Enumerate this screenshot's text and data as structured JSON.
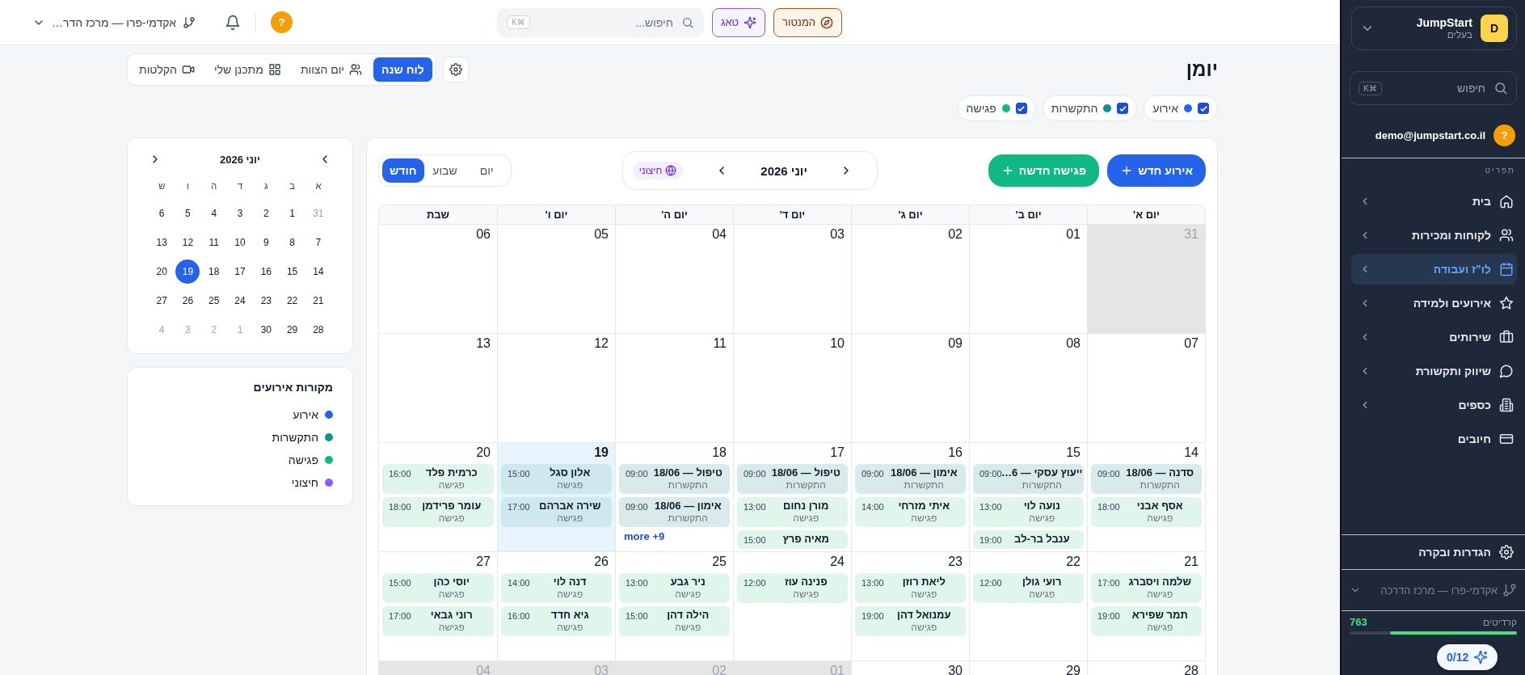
{
  "sidebar": {
    "workspace": {
      "avatar": "D",
      "name": "JumpStart",
      "role": "בעלים"
    },
    "search": {
      "placeholder": "חיפוש",
      "shortcut": "⌘K"
    },
    "user": {
      "avatar": "?",
      "email": "demo@jumpstart.co.il"
    },
    "section_label": "תפריט",
    "items": [
      {
        "label": "בית",
        "selected": false,
        "expandable": true
      },
      {
        "label": "לקוחות ומכירות",
        "selected": false,
        "expandable": true
      },
      {
        "label": "לו\"ז ועבודה",
        "selected": true,
        "expandable": true
      },
      {
        "label": "אירועים ולמידה",
        "selected": false,
        "expandable": true
      },
      {
        "label": "שירותים",
        "selected": false,
        "expandable": true
      },
      {
        "label": "שיווק ותקשורת",
        "selected": false,
        "expandable": true
      },
      {
        "label": "כספים",
        "selected": false,
        "expandable": true
      },
      {
        "label": "חיובים",
        "selected": false,
        "expandable": false
      }
    ],
    "settings": "הגדרות ובקרה",
    "branch": "אקדמי-פרו — מרכז הדרכה",
    "credits": {
      "label": "קרדיטים",
      "value": "763",
      "level": 0.76
    },
    "tasks_badge": "0/12"
  },
  "topbar": {
    "buttons": [
      {
        "label": "המנטור",
        "kind": "mentor"
      },
      {
        "label": "טאג",
        "kind": "ai"
      }
    ],
    "search": {
      "placeholder": "חיפוש...",
      "shortcut": "⌘K"
    },
    "avatar": "?",
    "branch": "אקדמי-פרו — מרכז הדר…"
  },
  "page": {
    "title": "יומן",
    "view_tabs": [
      {
        "label": "לוח שנה",
        "selected": true
      },
      {
        "label": "יום הצוות",
        "selected": false
      },
      {
        "label": "מתכנן שלי",
        "selected": false
      },
      {
        "label": "הקלטות",
        "selected": false
      }
    ],
    "filters": [
      {
        "label": "אירוע",
        "checked": true,
        "color": "#2563eb"
      },
      {
        "label": "התקשרות",
        "checked": true,
        "color": "#0d9488"
      },
      {
        "label": "פגישה",
        "checked": true,
        "color": "#10b981"
      }
    ]
  },
  "calendar": {
    "actions": [
      {
        "label": "אירוע חדש",
        "kind": "event"
      },
      {
        "label": "פגישה חדשה",
        "kind": "meeting"
      }
    ],
    "month": "יוני 2026",
    "source_badge": "חיצוני",
    "modes": [
      {
        "label": "יום",
        "selected": false
      },
      {
        "label": "שבוע",
        "selected": false
      },
      {
        "label": "חודש",
        "selected": true
      }
    ],
    "weekdays": [
      "יום א'",
      "יום ב'",
      "יום ג'",
      "יום ד'",
      "יום ה'",
      "יום ו'",
      "שבת"
    ],
    "weeks": [
      {
        "days": [
          {
            "date": "31",
            "muted": true,
            "today": false
          },
          {
            "date": "01",
            "muted": false,
            "today": false
          },
          {
            "date": "02",
            "muted": false,
            "today": false
          },
          {
            "date": "03",
            "muted": false,
            "today": false
          },
          {
            "date": "04",
            "muted": false,
            "today": false
          },
          {
            "date": "05",
            "muted": false,
            "today": false
          },
          {
            "date": "06",
            "muted": false,
            "today": false
          }
        ]
      },
      {
        "days": [
          {
            "date": "07",
            "muted": false,
            "today": false
          },
          {
            "date": "08",
            "muted": false,
            "today": false
          },
          {
            "date": "09",
            "muted": false,
            "today": false
          },
          {
            "date": "10",
            "muted": false,
            "today": false
          },
          {
            "date": "11",
            "muted": false,
            "today": false
          },
          {
            "date": "12",
            "muted": false,
            "today": false
          },
          {
            "date": "13",
            "muted": false,
            "today": false
          }
        ]
      },
      {
        "days": [
          {
            "date": "14",
            "muted": false,
            "today": false,
            "events": [
              {
                "title": "סדנה — 18/06",
                "time": "09:00",
                "type": "התקשרות",
                "kind": "call"
              },
              {
                "title": "אסף אבני",
                "time": "18:00",
                "type": "פגישה",
                "kind": "meeting"
              }
            ]
          },
          {
            "date": "15",
            "muted": false,
            "today": false,
            "events": [
              {
                "title": "ייעוץ עסקי — 6…",
                "time": "09:00",
                "type": "התקשרות",
                "kind": "call"
              },
              {
                "title": "נועה לוי",
                "time": "13:00",
                "type": "פגישה",
                "kind": "meeting"
              },
              {
                "title": "ענבל בר-לב",
                "time": "19:00",
                "kind": "meeting"
              }
            ]
          },
          {
            "date": "16",
            "muted": false,
            "today": false,
            "events": [
              {
                "title": "אימון — 18/06",
                "time": "09:00",
                "type": "התקשרות",
                "kind": "call"
              },
              {
                "title": "איתי מזרחי",
                "time": "14:00",
                "type": "פגישה",
                "kind": "meeting"
              }
            ]
          },
          {
            "date": "17",
            "muted": false,
            "today": false,
            "events": [
              {
                "title": "טיפול — 18/06",
                "time": "09:00",
                "type": "התקשרות",
                "kind": "call"
              },
              {
                "title": "מורן נחום",
                "time": "13:00",
                "type": "פגישה",
                "kind": "meeting"
              },
              {
                "title": "מאיה פרץ",
                "time": "15:00",
                "kind": "meeting"
              }
            ]
          },
          {
            "date": "18",
            "muted": false,
            "today": false,
            "events": [
              {
                "title": "טיפול — 18/06",
                "time": "09:00",
                "type": "התקשרות",
                "kind": "call"
              },
              {
                "title": "אימון — 18/06",
                "time": "09:00",
                "type": "התקשרות",
                "kind": "call"
              }
            ],
            "more": "9+ more"
          },
          {
            "date": "19",
            "muted": false,
            "today": true,
            "events": [
              {
                "title": "אלון סגל",
                "time": "15:00",
                "type": "פגישה",
                "kind": "meeting"
              },
              {
                "title": "שירה אברהם",
                "time": "17:00",
                "type": "פגישה",
                "kind": "meeting"
              }
            ]
          },
          {
            "date": "20",
            "muted": false,
            "today": false,
            "events": [
              {
                "title": "כרמית פלד",
                "time": "16:00",
                "type": "פגישה",
                "kind": "meeting"
              },
              {
                "title": "עומר פרידמן",
                "time": "18:00",
                "type": "פגישה",
                "kind": "meeting"
              }
            ]
          }
        ]
      },
      {
        "days": [
          {
            "date": "21",
            "muted": false,
            "today": false,
            "events": [
              {
                "title": "שלמה ויסברג",
                "time": "17:00",
                "type": "פגישה",
                "kind": "meeting"
              },
              {
                "title": "תמר שפירא",
                "time": "19:00",
                "type": "פגישה",
                "kind": "meeting"
              }
            ]
          },
          {
            "date": "22",
            "muted": false,
            "today": false,
            "events": [
              {
                "title": "רועי גולן",
                "time": "12:00",
                "type": "פגישה",
                "kind": "meeting"
              }
            ]
          },
          {
            "date": "23",
            "muted": false,
            "today": false,
            "events": [
              {
                "title": "ליאת רוזן",
                "time": "13:00",
                "type": "פגישה",
                "kind": "meeting"
              },
              {
                "title": "עמנואל דהן",
                "time": "19:00",
                "type": "פגישה",
                "kind": "meeting"
              }
            ]
          },
          {
            "date": "24",
            "muted": false,
            "today": false,
            "events": [
              {
                "title": "פנינה עוז",
                "time": "12:00",
                "type": "פגישה",
                "kind": "meeting"
              }
            ]
          },
          {
            "date": "25",
            "muted": false,
            "today": false,
            "events": [
              {
                "title": "ניר גבע",
                "time": "13:00",
                "type": "פגישה",
                "kind": "meeting"
              },
              {
                "title": "הילה דהן",
                "time": "15:00",
                "type": "פגישה",
                "kind": "meeting"
              }
            ]
          },
          {
            "date": "26",
            "muted": false,
            "today": false,
            "events": [
              {
                "title": "דנה לוי",
                "time": "14:00",
                "type": "פגישה",
                "kind": "meeting"
              },
              {
                "title": "גיא חדד",
                "time": "16:00",
                "type": "פגישה",
                "kind": "meeting"
              }
            ]
          },
          {
            "date": "27",
            "muted": false,
            "today": false,
            "events": [
              {
                "title": "יוסי כהן",
                "time": "15:00",
                "type": "פגישה",
                "kind": "meeting"
              },
              {
                "title": "רוני גבאי",
                "time": "17:00",
                "type": "פגישה",
                "kind": "meeting"
              }
            ]
          }
        ]
      },
      {
        "days": [
          {
            "date": "28",
            "muted": false,
            "today": false
          },
          {
            "date": "29",
            "muted": false,
            "today": false
          },
          {
            "date": "30",
            "muted": false,
            "today": false
          },
          {
            "date": "01",
            "muted": true,
            "today": false
          },
          {
            "date": "02",
            "muted": true,
            "today": false
          },
          {
            "date": "03",
            "muted": true,
            "today": false
          },
          {
            "date": "04",
            "muted": true,
            "today": false
          }
        ]
      }
    ]
  },
  "mini_calendar": {
    "month": "יוני 2026",
    "weekdays": [
      "א",
      "ב",
      "ג",
      "ד",
      "ה",
      "ו",
      "ש"
    ],
    "weeks": [
      [
        {
          "d": "31",
          "muted": true,
          "selected": false
        },
        {
          "d": "1",
          "muted": false,
          "selected": false
        },
        {
          "d": "2",
          "muted": false,
          "selected": false
        },
        {
          "d": "3",
          "muted": false,
          "selected": false
        },
        {
          "d": "4",
          "muted": false,
          "selected": false
        },
        {
          "d": "5",
          "muted": false,
          "selected": false
        },
        {
          "d": "6",
          "muted": false,
          "selected": false
        }
      ],
      [
        {
          "d": "7",
          "muted": false,
          "selected": false
        },
        {
          "d": "8",
          "muted": false,
          "selected": false
        },
        {
          "d": "9",
          "muted": false,
          "selected": false
        },
        {
          "d": "10",
          "muted": false,
          "selected": false
        },
        {
          "d": "11",
          "muted": false,
          "selected": false
        },
        {
          "d": "12",
          "muted": false,
          "selected": false
        },
        {
          "d": "13",
          "muted": false,
          "selected": false
        }
      ],
      [
        {
          "d": "14",
          "muted": false,
          "selected": false
        },
        {
          "d": "15",
          "muted": false,
          "selected": false
        },
        {
          "d": "16",
          "muted": false,
          "selected": false
        },
        {
          "d": "17",
          "muted": false,
          "selected": false
        },
        {
          "d": "18",
          "muted": false,
          "selected": false
        },
        {
          "d": "19",
          "muted": false,
          "selected": true
        },
        {
          "d": "20",
          "muted": false,
          "selected": false
        }
      ],
      [
        {
          "d": "21",
          "muted": false,
          "selected": false
        },
        {
          "d": "22",
          "muted": false,
          "selected": false
        },
        {
          "d": "23",
          "muted": false,
          "selected": false
        },
        {
          "d": "24",
          "muted": false,
          "selected": false
        },
        {
          "d": "25",
          "muted": false,
          "selected": false
        },
        {
          "d": "26",
          "muted": false,
          "selected": false
        },
        {
          "d": "27",
          "muted": false,
          "selected": false
        }
      ],
      [
        {
          "d": "28",
          "muted": false,
          "selected": false
        },
        {
          "d": "29",
          "muted": false,
          "selected": false
        },
        {
          "d": "30",
          "muted": false,
          "selected": false
        },
        {
          "d": "1",
          "muted": true,
          "selected": false
        },
        {
          "d": "2",
          "muted": true,
          "selected": false
        },
        {
          "d": "3",
          "muted": true,
          "selected": false
        },
        {
          "d": "4",
          "muted": true,
          "selected": false
        }
      ]
    ]
  },
  "sources": {
    "title": "מקורות אירועים",
    "items": [
      {
        "label": "אירוע",
        "color": "#2563eb"
      },
      {
        "label": "התקשרות",
        "color": "#0d9488"
      },
      {
        "label": "פגישה",
        "color": "#10b981"
      },
      {
        "label": "חיצוני",
        "color": "#8b5cf6"
      }
    ]
  }
}
